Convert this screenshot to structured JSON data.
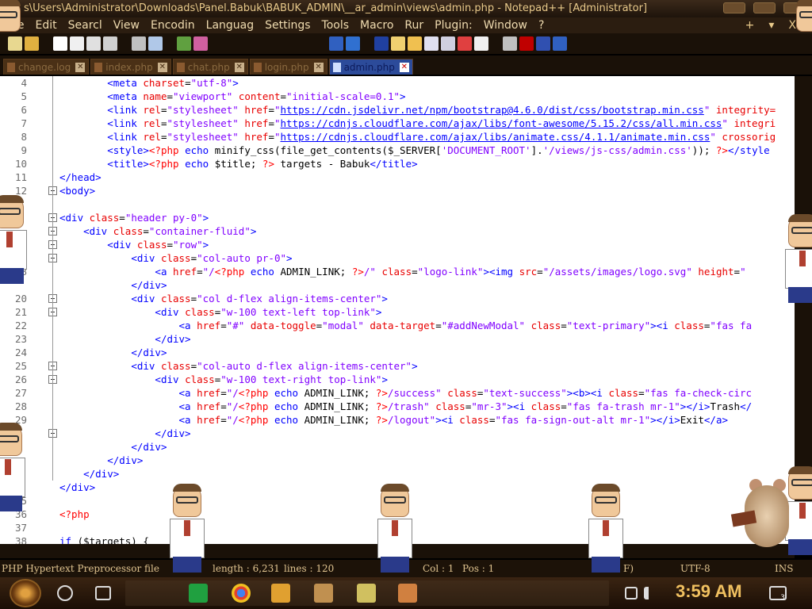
{
  "window": {
    "title": "s\\Users\\Administrator\\Downloads\\Panel.Babuk\\BABUK_ADMIN\\__ar_admin\\views\\admin.php - Notepad++ [Administrator]"
  },
  "menu": {
    "items": [
      "File",
      "Edit",
      "Search",
      "View",
      "Encoding",
      "Language",
      "Settings",
      "Tools",
      "Macro",
      "Run",
      "Plugins",
      "Window",
      "?"
    ],
    "visible_labels": [
      "le",
      "Edit",
      "Searcl",
      "View",
      "Encodin",
      "Languag",
      "Settings",
      "Tools",
      "Macro",
      "Rur",
      "Plugin:",
      "Window",
      "?"
    ],
    "right_plus": "+",
    "right_arrow": "▾",
    "right_close": "X"
  },
  "tabs": [
    {
      "label": "change.log",
      "active": false
    },
    {
      "label": "index.php",
      "active": false
    },
    {
      "label": "chat.php",
      "active": false
    },
    {
      "label": "login.php",
      "active": false
    },
    {
      "label": "admin.php",
      "active": true
    }
  ],
  "tab_close_glyph": "✕",
  "editor": {
    "lines": [
      {
        "n": "4",
        "code": [
          [
            "bk",
            "        "
          ],
          [
            "kw",
            "<meta "
          ],
          [
            "at",
            "charset"
          ],
          [
            "bk",
            "="
          ],
          [
            "st",
            "\"utf-8\""
          ],
          [
            "kw",
            ">"
          ]
        ]
      },
      {
        "n": "5",
        "code": [
          [
            "bk",
            "        "
          ],
          [
            "kw",
            "<meta "
          ],
          [
            "at",
            "name"
          ],
          [
            "bk",
            "="
          ],
          [
            "st",
            "\"viewport\""
          ],
          [
            "bk",
            " "
          ],
          [
            "at",
            "content"
          ],
          [
            "bk",
            "="
          ],
          [
            "st",
            "\"initial-scale=0.1\""
          ],
          [
            "kw",
            ">"
          ]
        ]
      },
      {
        "n": "6",
        "code": [
          [
            "bk",
            "        "
          ],
          [
            "kw",
            "<link "
          ],
          [
            "at",
            "rel"
          ],
          [
            "bk",
            "="
          ],
          [
            "st",
            "\"stylesheet\""
          ],
          [
            "bk",
            " "
          ],
          [
            "at",
            "href"
          ],
          [
            "bk",
            "="
          ],
          [
            "st",
            "\""
          ],
          [
            "ul",
            "https://cdn.jsdelivr.net/npm/bootstrap@4.6.0/dist/css/bootstrap.min.css"
          ],
          [
            "st",
            "\""
          ],
          [
            "bk",
            " "
          ],
          [
            "at",
            "integrity="
          ]
        ]
      },
      {
        "n": "7",
        "code": [
          [
            "bk",
            "        "
          ],
          [
            "kw",
            "<link "
          ],
          [
            "at",
            "rel"
          ],
          [
            "bk",
            "="
          ],
          [
            "st",
            "\"stylesheet\""
          ],
          [
            "bk",
            " "
          ],
          [
            "at",
            "href"
          ],
          [
            "bk",
            "="
          ],
          [
            "st",
            "\""
          ],
          [
            "ul",
            "https://cdnjs.cloudflare.com/ajax/libs/font-awesome/5.15.2/css/all.min.css"
          ],
          [
            "st",
            "\""
          ],
          [
            "bk",
            " "
          ],
          [
            "at",
            "integri"
          ]
        ]
      },
      {
        "n": "8",
        "code": [
          [
            "bk",
            "        "
          ],
          [
            "kw",
            "<link "
          ],
          [
            "at",
            "rel"
          ],
          [
            "bk",
            "="
          ],
          [
            "st",
            "\"stylesheet\""
          ],
          [
            "bk",
            " "
          ],
          [
            "at",
            "href"
          ],
          [
            "bk",
            "="
          ],
          [
            "st",
            "\""
          ],
          [
            "ul",
            "https://cdnjs.cloudflare.com/ajax/libs/animate.css/4.1.1/animate.min.css"
          ],
          [
            "st",
            "\""
          ],
          [
            "bk",
            " "
          ],
          [
            "at",
            "crossorig"
          ]
        ]
      },
      {
        "n": "9",
        "code": [
          [
            "bk",
            "        "
          ],
          [
            "kw",
            "<style>"
          ],
          [
            "ph",
            "<?php "
          ],
          [
            "kw",
            "echo "
          ],
          [
            "bk",
            "minify_css(file_get_contents($_SERVER["
          ],
          [
            "st",
            "'DOCUMENT_ROOT'"
          ],
          [
            "bk",
            "]."
          ],
          [
            "st",
            "'/views/js-css/admin.css'"
          ],
          [
            "bk",
            ")); "
          ],
          [
            "ph",
            "?>"
          ],
          [
            "kw",
            "</style"
          ]
        ]
      },
      {
        "n": "10",
        "code": [
          [
            "bk",
            "        "
          ],
          [
            "kw",
            "<title>"
          ],
          [
            "ph",
            "<?php "
          ],
          [
            "kw",
            "echo "
          ],
          [
            "bk",
            "$title; "
          ],
          [
            "ph",
            "?>"
          ],
          [
            "bk",
            " targets - Babuk"
          ],
          [
            "kw",
            "</title>"
          ]
        ]
      },
      {
        "n": "11",
        "code": [
          [
            "kw",
            "</head>"
          ]
        ]
      },
      {
        "n": "12",
        "code": [
          [
            "kw",
            "<body>"
          ]
        ]
      },
      {
        "n": "",
        "code": []
      },
      {
        "n": "",
        "code": [
          [
            "kw",
            "<div "
          ],
          [
            "at",
            "class"
          ],
          [
            "bk",
            "="
          ],
          [
            "st",
            "\"header py-0\""
          ],
          [
            "kw",
            ">"
          ]
        ]
      },
      {
        "n": "",
        "code": [
          [
            "bk",
            "    "
          ],
          [
            "kw",
            "<div "
          ],
          [
            "at",
            "class"
          ],
          [
            "bk",
            "="
          ],
          [
            "st",
            "\"container-fluid\""
          ],
          [
            "kw",
            ">"
          ]
        ]
      },
      {
        "n": "",
        "code": [
          [
            "bk",
            "        "
          ],
          [
            "kw",
            "<div "
          ],
          [
            "at",
            "class"
          ],
          [
            "bk",
            "="
          ],
          [
            "st",
            "\"row\""
          ],
          [
            "kw",
            ">"
          ]
        ]
      },
      {
        "n": "",
        "code": [
          [
            "bk",
            "            "
          ],
          [
            "kw",
            "<div "
          ],
          [
            "at",
            "class"
          ],
          [
            "bk",
            "="
          ],
          [
            "st",
            "\"col-auto pr-0\""
          ],
          [
            "kw",
            ">"
          ]
        ]
      },
      {
        "n": "8",
        "code": [
          [
            "bk",
            "                "
          ],
          [
            "kw",
            "<a "
          ],
          [
            "at",
            "href"
          ],
          [
            "bk",
            "="
          ],
          [
            "st",
            "\"/"
          ],
          [
            "ph",
            "<?php "
          ],
          [
            "kw",
            "echo "
          ],
          [
            "bk",
            "ADMIN_LINK; "
          ],
          [
            "ph",
            "?>"
          ],
          [
            "st",
            "/\""
          ],
          [
            "bk",
            " "
          ],
          [
            "at",
            "class"
          ],
          [
            "bk",
            "="
          ],
          [
            "st",
            "\"logo-link\""
          ],
          [
            "kw",
            "><img "
          ],
          [
            "at",
            "src"
          ],
          [
            "bk",
            "="
          ],
          [
            "st",
            "\"/assets/images/logo.svg\""
          ],
          [
            "bk",
            " "
          ],
          [
            "at",
            "height"
          ],
          [
            "bk",
            "="
          ],
          [
            "st",
            "\""
          ]
        ]
      },
      {
        "n": "",
        "code": [
          [
            "bk",
            "            "
          ],
          [
            "kw",
            "</div>"
          ]
        ]
      },
      {
        "n": "20",
        "code": [
          [
            "bk",
            "            "
          ],
          [
            "kw",
            "<div "
          ],
          [
            "at",
            "class"
          ],
          [
            "bk",
            "="
          ],
          [
            "st",
            "\"col d-flex align-items-center\""
          ],
          [
            "kw",
            ">"
          ]
        ]
      },
      {
        "n": "21",
        "code": [
          [
            "bk",
            "                "
          ],
          [
            "kw",
            "<div "
          ],
          [
            "at",
            "class"
          ],
          [
            "bk",
            "="
          ],
          [
            "st",
            "\"w-100 text-left top-link\""
          ],
          [
            "kw",
            ">"
          ]
        ]
      },
      {
        "n": "22",
        "code": [
          [
            "bk",
            "                    "
          ],
          [
            "kw",
            "<a "
          ],
          [
            "at",
            "href"
          ],
          [
            "bk",
            "="
          ],
          [
            "st",
            "\"#\""
          ],
          [
            "bk",
            " "
          ],
          [
            "at",
            "data-toggle"
          ],
          [
            "bk",
            "="
          ],
          [
            "st",
            "\"modal\""
          ],
          [
            "bk",
            " "
          ],
          [
            "at",
            "data-target"
          ],
          [
            "bk",
            "="
          ],
          [
            "st",
            "\"#addNewModal\""
          ],
          [
            "bk",
            " "
          ],
          [
            "at",
            "class"
          ],
          [
            "bk",
            "="
          ],
          [
            "st",
            "\"text-primary\""
          ],
          [
            "kw",
            "><i "
          ],
          [
            "at",
            "class"
          ],
          [
            "bk",
            "="
          ],
          [
            "st",
            "\"fas fa"
          ]
        ]
      },
      {
        "n": "23",
        "code": [
          [
            "bk",
            "                "
          ],
          [
            "kw",
            "</div>"
          ]
        ]
      },
      {
        "n": "24",
        "code": [
          [
            "bk",
            "            "
          ],
          [
            "kw",
            "</div>"
          ]
        ]
      },
      {
        "n": "25",
        "code": [
          [
            "bk",
            "            "
          ],
          [
            "kw",
            "<div "
          ],
          [
            "at",
            "class"
          ],
          [
            "bk",
            "="
          ],
          [
            "st",
            "\"col-auto d-flex align-items-center\""
          ],
          [
            "kw",
            ">"
          ]
        ]
      },
      {
        "n": "26",
        "code": [
          [
            "bk",
            "                "
          ],
          [
            "kw",
            "<div "
          ],
          [
            "at",
            "class"
          ],
          [
            "bk",
            "="
          ],
          [
            "st",
            "\"w-100 text-right top-link\""
          ],
          [
            "kw",
            ">"
          ]
        ]
      },
      {
        "n": "27",
        "code": [
          [
            "bk",
            "                    "
          ],
          [
            "kw",
            "<a "
          ],
          [
            "at",
            "href"
          ],
          [
            "bk",
            "="
          ],
          [
            "st",
            "\"/"
          ],
          [
            "ph",
            "<?php "
          ],
          [
            "kw",
            "echo "
          ],
          [
            "bk",
            "ADMIN_LINK; "
          ],
          [
            "ph",
            "?>"
          ],
          [
            "st",
            "/success\""
          ],
          [
            "bk",
            " "
          ],
          [
            "at",
            "class"
          ],
          [
            "bk",
            "="
          ],
          [
            "st",
            "\"text-success\""
          ],
          [
            "kw",
            "><b><i "
          ],
          [
            "at",
            "class"
          ],
          [
            "bk",
            "="
          ],
          [
            "st",
            "\"fas fa-check-circ"
          ]
        ]
      },
      {
        "n": "28",
        "code": [
          [
            "bk",
            "                    "
          ],
          [
            "kw",
            "<a "
          ],
          [
            "at",
            "href"
          ],
          [
            "bk",
            "="
          ],
          [
            "st",
            "\"/"
          ],
          [
            "ph",
            "<?php "
          ],
          [
            "kw",
            "echo "
          ],
          [
            "bk",
            "ADMIN_LINK; "
          ],
          [
            "ph",
            "?>"
          ],
          [
            "st",
            "/trash\""
          ],
          [
            "bk",
            " "
          ],
          [
            "at",
            "class"
          ],
          [
            "bk",
            "="
          ],
          [
            "st",
            "\"mr-3\""
          ],
          [
            "kw",
            "><i "
          ],
          [
            "at",
            "class"
          ],
          [
            "bk",
            "="
          ],
          [
            "st",
            "\"fas fa-trash mr-1\""
          ],
          [
            "kw",
            "></i>"
          ],
          [
            "bk",
            "Trash"
          ],
          [
            "kw",
            "</"
          ]
        ]
      },
      {
        "n": "29",
        "code": [
          [
            "bk",
            "                    "
          ],
          [
            "kw",
            "<a "
          ],
          [
            "at",
            "href"
          ],
          [
            "bk",
            "="
          ],
          [
            "st",
            "\"/"
          ],
          [
            "ph",
            "<?php "
          ],
          [
            "kw",
            "echo "
          ],
          [
            "bk",
            "ADMIN_LINK; "
          ],
          [
            "ph",
            "?>"
          ],
          [
            "st",
            "/logout\""
          ],
          [
            "kw",
            "><i "
          ],
          [
            "at",
            "class"
          ],
          [
            "bk",
            "="
          ],
          [
            "st",
            "\"fas fa-sign-out-alt mr-1\""
          ],
          [
            "kw",
            "></i>"
          ],
          [
            "bk",
            "Exit"
          ],
          [
            "kw",
            "</a>"
          ]
        ]
      },
      {
        "n": "",
        "code": [
          [
            "bk",
            "                "
          ],
          [
            "kw",
            "</div>"
          ]
        ]
      },
      {
        "n": "",
        "code": [
          [
            "bk",
            "            "
          ],
          [
            "kw",
            "</div>"
          ]
        ]
      },
      {
        "n": "",
        "code": [
          [
            "bk",
            "        "
          ],
          [
            "kw",
            "</div>"
          ]
        ]
      },
      {
        "n": "",
        "code": [
          [
            "bk",
            "    "
          ],
          [
            "kw",
            "</div>"
          ]
        ]
      },
      {
        "n": "",
        "code": [
          [
            "kw",
            "</div>"
          ]
        ]
      },
      {
        "n": "35",
        "code": []
      },
      {
        "n": "36",
        "code": [
          [
            "ph",
            "<?php"
          ]
        ]
      },
      {
        "n": "37",
        "code": []
      },
      {
        "n": "38",
        "code": [
          [
            "kw",
            "if "
          ],
          [
            "bk",
            "($targets) {"
          ]
        ]
      }
    ]
  },
  "status": {
    "file_type": "PHP Hypertext Preprocessor file",
    "length": "length : 6,231",
    "lines": "lines : 120",
    "ln": "L",
    "col": "Col : 1",
    "pos": "Pos : 1",
    "eol": "F)",
    "encoding": "UTF-8",
    "mode": "INS"
  },
  "taskbar": {
    "clock": "3:59 AM",
    "notification_count": "3"
  },
  "colors": {
    "accent": "#e8c98a",
    "editor_bg": "#ffffff",
    "tag": "#0000ff",
    "attr": "#e80000",
    "string": "#8000ff",
    "php": "#ff0000"
  }
}
